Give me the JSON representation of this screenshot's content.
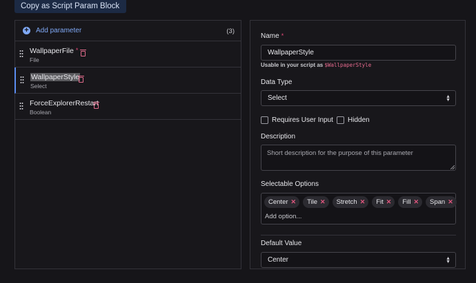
{
  "toolbar": {
    "copy_label": "Copy as Script Param Block"
  },
  "params_panel": {
    "add_label": "Add parameter",
    "count": "(3)",
    "items": [
      {
        "name": "WallpaperFile",
        "type": "File",
        "required": "*"
      },
      {
        "name": "WallpaperStyle",
        "type": "Select"
      },
      {
        "name": "ForceExplorerRestart",
        "type": "Boolean"
      }
    ]
  },
  "editor": {
    "name_label": "Name",
    "required_star": "*",
    "name_value": "WallpaperStyle",
    "usage_prefix": "Usable in your script as ",
    "usage_var": "$WallpaperStyle",
    "data_type_label": "Data Type",
    "data_type_value": "Select",
    "requires_input_label": "Requires User Input",
    "hidden_label": "Hidden",
    "description_label": "Description",
    "description_placeholder": "Short description for the purpose of this parameter",
    "options_label": "Selectable Options",
    "options": [
      "Center",
      "Tile",
      "Stretch",
      "Fit",
      "Fill",
      "Span"
    ],
    "add_option_placeholder": "Add option...",
    "default_label": "Default Value",
    "default_value": "Center"
  },
  "colors": {
    "accent": "#7fa8f5",
    "danger": "#e26c8c",
    "selected_border": "#5b8df0"
  }
}
